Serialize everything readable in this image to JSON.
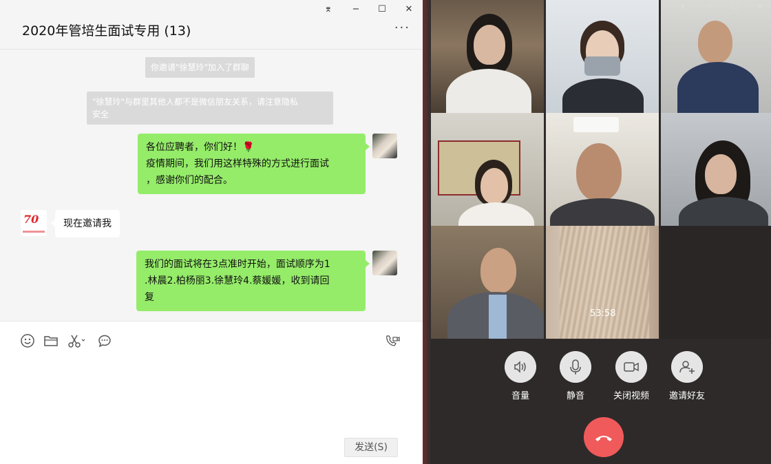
{
  "chat": {
    "title": "2020年管培生面试专用 (13)",
    "window_controls": [
      "⌆",
      "−",
      "☐",
      "✕"
    ],
    "more_icon": "···",
    "system_notices": [
      "你邀请\"徐慧玲\"加入了群聊",
      "\"徐慧玲\"与群里其他人都不是微信朋友关系，请注意隐私",
      "安全"
    ],
    "messages": [
      {
        "from": "me",
        "lines": [
          "各位应聘者，你们好！🌹",
          "疫情期间，我们用这样特殊的方式进行面试",
          "，感谢你们的配合。"
        ]
      },
      {
        "from": "other",
        "lines": [
          "现在邀请我"
        ]
      },
      {
        "from": "me",
        "lines": [
          "我们的面试将在3点准时开始，面试顺序为1",
          ".林晨2.柏杨丽3.徐慧玲4.蔡媛媛，收到请回",
          "复"
        ]
      }
    ],
    "send_label": "发送(S)",
    "tool_icons": [
      "emoji-icon",
      "folder-icon",
      "scissors-icon",
      "chat-bubble-icon",
      "video-call-icon"
    ],
    "accent_color": "#95ec69"
  },
  "call": {
    "window_controls": [
      "⌆",
      "−",
      "☐",
      "✕"
    ],
    "timer": "53:58",
    "controls": [
      {
        "label": "音量",
        "icon": "speaker-icon"
      },
      {
        "label": "静音",
        "icon": "microphone-icon"
      },
      {
        "label": "关闭视频",
        "icon": "video-camera-icon"
      },
      {
        "label": "邀请好友",
        "icon": "add-user-icon"
      }
    ],
    "hangup_icon": "hang-up-icon",
    "hangup_color": "#f05a5a"
  }
}
